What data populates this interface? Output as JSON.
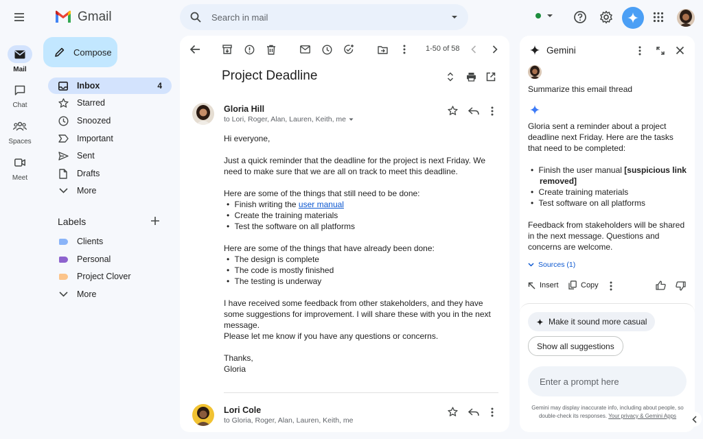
{
  "app": {
    "name": "Gmail"
  },
  "rail": [
    {
      "label": "Mail",
      "icon": "mail-icon"
    },
    {
      "label": "Chat",
      "icon": "chat-icon"
    },
    {
      "label": "Spaces",
      "icon": "spaces-icon"
    },
    {
      "label": "Meet",
      "icon": "meet-icon"
    }
  ],
  "search": {
    "placeholder": "Search in mail"
  },
  "compose": {
    "label": "Compose"
  },
  "nav": [
    {
      "label": "Inbox",
      "count": "4",
      "icon": "inbox-icon"
    },
    {
      "label": "Starred",
      "icon": "star-icon"
    },
    {
      "label": "Snoozed",
      "icon": "clock-icon"
    },
    {
      "label": "Important",
      "icon": "important-icon"
    },
    {
      "label": "Sent",
      "icon": "send-icon"
    },
    {
      "label": "Drafts",
      "icon": "draft-icon"
    },
    {
      "label": "More",
      "icon": "chevron-down-icon"
    }
  ],
  "labels": {
    "heading": "Labels",
    "items": [
      {
        "label": "Clients",
        "color": "#8ab4f8"
      },
      {
        "label": "Personal",
        "color": "#8e63ce"
      },
      {
        "label": "Project Clover",
        "color": "#fcc48a"
      }
    ],
    "more": "More"
  },
  "toolbar": {
    "pagination": "1-50 of 58"
  },
  "email": {
    "subject": "Project Deadline",
    "messages": [
      {
        "sender": "Gloria Hill",
        "recipients": "to Lori, Roger, Alan, Lauren, Keith, me",
        "greeting": "Hi everyone,",
        "para1": "Just a quick reminder that the deadline for the project is next Friday. We need to make sure that we are all on track to meet this deadline.",
        "todo_intro": "Here are some of the things that still need to be done:",
        "todo_item1_prefix": "Finish writing the ",
        "todo_item1_link": "user manual",
        "todo_items": [
          "Create the training materials",
          "Test the software on all platforms"
        ],
        "done_intro": "Here are some of the things that have already been done:",
        "done_items": [
          "The design is complete",
          "The code is mostly finished",
          "The testing is underway"
        ],
        "para2": "I have received some feedback from other stakeholders, and they have some suggestions for improvement. I will share these with you in the next message.",
        "para3": "Please let me know if you have any questions or concerns.",
        "signoff": "Thanks,",
        "signature": "Gloria"
      },
      {
        "sender": "Lori Cole",
        "recipients": "to Gloria, Roger, Alan, Lauren, Keith, me"
      }
    ]
  },
  "gemini": {
    "title": "Gemini",
    "user_prompt": "Summarize this email thread",
    "response_intro": "Gloria sent a reminder about a project deadline next Friday. Here are the tasks that need to be completed:",
    "task1_prefix": "Finish the user manual ",
    "task1_bold": "[suspicious link removed]",
    "tasks": [
      "Create training materials",
      "Test software on all platforms"
    ],
    "response_outro": "Feedback from stakeholders will be shared in the next message. Questions and concerns are welcome.",
    "sources": "Sources (1)",
    "insert": "Insert",
    "copy": "Copy",
    "suggestion": "Make it sound more casual",
    "show_all": "Show all suggestions",
    "prompt_placeholder": "Enter a prompt here",
    "disclaimer": "Gemini may display inaccurate info, including about people, so double-check its responses.",
    "disclaimer_link": "Your privacy & Gemini Apps"
  },
  "colors": {
    "accent": "#0b57d0",
    "active_nav": "#d3e3fd",
    "compose": "#c2e7ff",
    "gemini_button": "#4b9ff5"
  }
}
